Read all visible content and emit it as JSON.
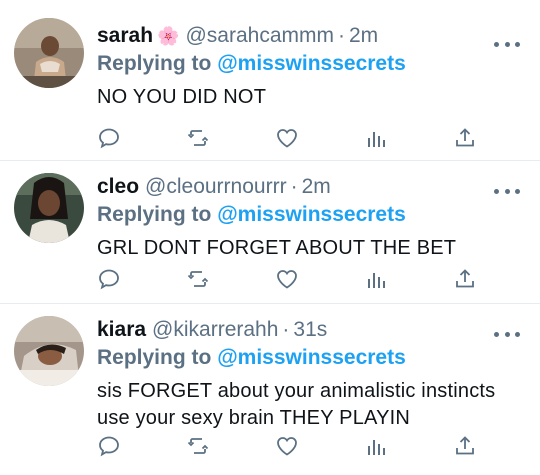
{
  "tweets": [
    {
      "name": "sarah",
      "emoji": "🌸",
      "handle": "@sarahcammm",
      "separator": "·",
      "time": "2m",
      "replying_prefix": "Replying to",
      "replying_to": "@misswinssecrets",
      "text": "NO YOU DID NOT"
    },
    {
      "name": "cleo",
      "emoji": "",
      "handle": "@cleourrnourrr",
      "separator": "·",
      "time": "2m",
      "replying_prefix": "Replying to",
      "replying_to": "@misswinssecrets",
      "text": "GRL DONT FORGET ABOUT THE BET"
    },
    {
      "name": "kiara",
      "emoji": "",
      "handle": "@kikarrerahh",
      "separator": "·",
      "time": "31s",
      "replying_prefix": "Replying to",
      "replying_to": "@misswinssecrets",
      "text_lines": [
        "sis FORGET about your animalistic instincts",
        "use your sexy brain THEY PLAYIN"
      ]
    }
  ],
  "icons": {
    "reply": "reply-icon",
    "retweet": "retweet-icon",
    "like": "heart-icon",
    "analytics": "analytics-icon",
    "share": "share-icon",
    "more": "more-icon"
  },
  "colors": {
    "mention": "#1da1f2",
    "secondary_text": "#5b7083",
    "icon": "#5b7083",
    "divider": "#e6ecf0"
  }
}
